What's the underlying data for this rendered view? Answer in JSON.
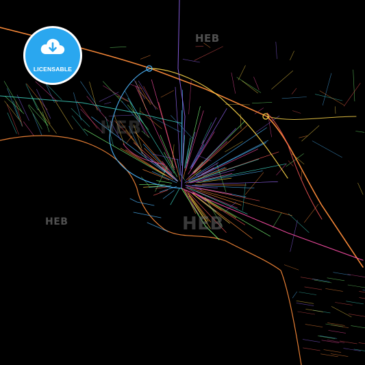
{
  "badge": {
    "label": "LICENSABLE",
    "icon": "cloud-download-icon",
    "color": "#2aa7ef"
  },
  "watermarks": [
    "HEB",
    "HEB",
    "HEB",
    "HEB"
  ],
  "colors": {
    "background": "#000000",
    "sea": "#000000",
    "roads": [
      "#ff8c3a",
      "#ffd84a",
      "#ff4fa8",
      "#4fb8ff",
      "#9b6bff",
      "#42e3d0",
      "#ff5a5a",
      "#7dff7a"
    ]
  }
}
